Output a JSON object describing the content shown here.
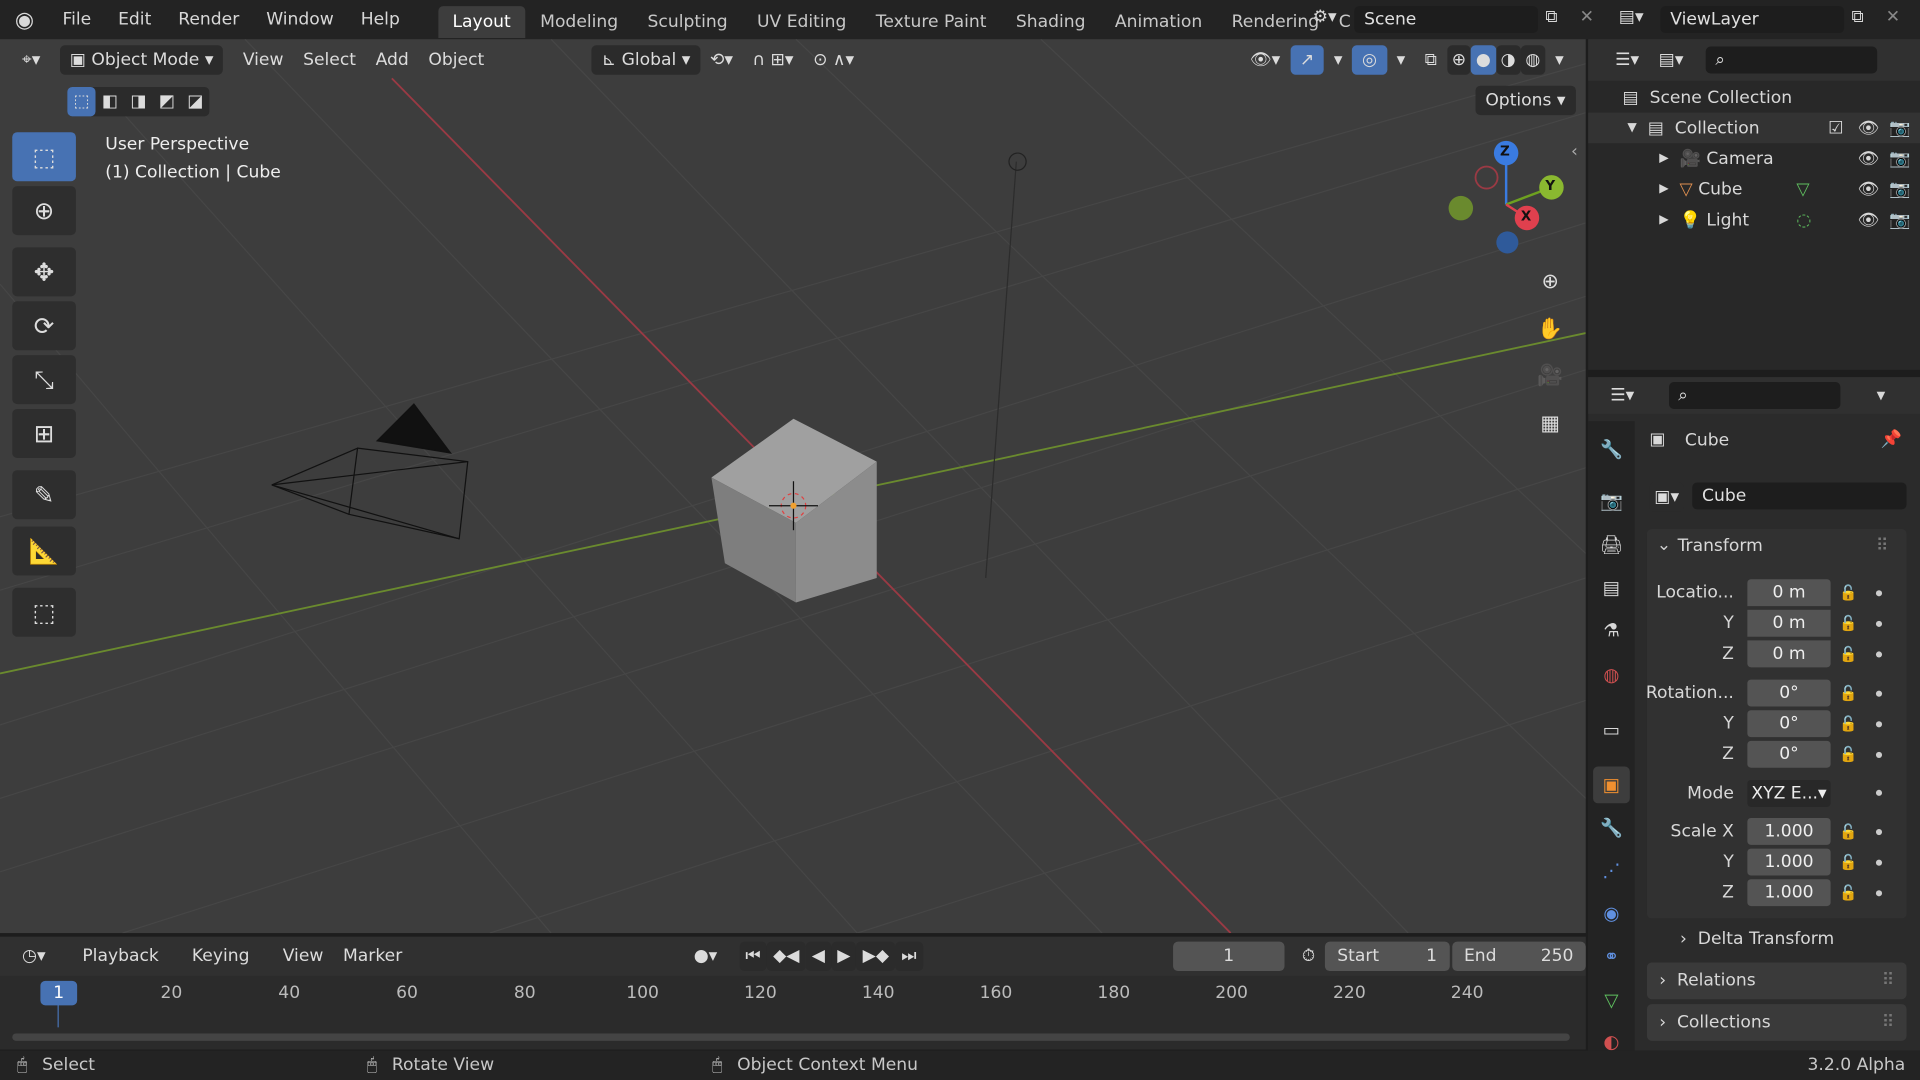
{
  "topbar": {
    "menus": [
      "File",
      "Edit",
      "Render",
      "Window",
      "Help"
    ],
    "workspaces": [
      "Layout",
      "Modeling",
      "Sculpting",
      "UV Editing",
      "Texture Paint",
      "Shading",
      "Animation",
      "Rendering",
      "C"
    ],
    "active_workspace": "Layout",
    "scene": "Scene",
    "view_layer": "ViewLayer"
  },
  "viewport": {
    "mode": "Object Mode",
    "menus": [
      "View",
      "Select",
      "Add",
      "Object"
    ],
    "orientation": "Global",
    "options": "Options",
    "overlay_title": "User Perspective",
    "overlay_subtitle": "(1) Collection | Cube",
    "gizmo": {
      "x": "X",
      "y": "Y",
      "z": "Z"
    },
    "tools": [
      "select-box",
      "cursor",
      "move",
      "rotate",
      "scale",
      "transform",
      "annotate",
      "measure",
      "add-cube"
    ],
    "colors": {
      "x_axis": "#c8303c",
      "y_axis": "#6e9a1e",
      "background": "#3d3d3d",
      "active": "#4772b3"
    }
  },
  "outliner": {
    "root": "Scene Collection",
    "collection": "Collection",
    "items": [
      {
        "name": "Camera",
        "icon": "camera"
      },
      {
        "name": "Cube",
        "icon": "mesh"
      },
      {
        "name": "Light",
        "icon": "light"
      }
    ]
  },
  "properties": {
    "object_name": "Cube",
    "data_name": "Cube",
    "transform_title": "Transform",
    "location": {
      "label": "Locatio...",
      "x": "0 m",
      "y": "0 m",
      "z": "0 m"
    },
    "rotation": {
      "label": "Rotation...",
      "x": "0°",
      "y": "0°",
      "z": "0°"
    },
    "mode_label": "Mode",
    "mode_value": "XYZ E...",
    "scale": {
      "label": "Scale X",
      "x": "1.000",
      "y": "1.000",
      "z": "1.000"
    },
    "axis_y": "Y",
    "axis_z": "Z",
    "delta": "Delta Transform",
    "relations": "Relations",
    "collections": "Collections"
  },
  "timeline": {
    "menus": [
      "Playback",
      "Keying",
      "View",
      "Marker"
    ],
    "current_frame": "1",
    "start_label": "Start",
    "start": "1",
    "end_label": "End",
    "end": "250",
    "ticks": [
      "20",
      "40",
      "60",
      "80",
      "100",
      "120",
      "140",
      "160",
      "180",
      "200",
      "220",
      "240"
    ],
    "playhead": "1"
  },
  "status": {
    "select": "Select",
    "rotate": "Rotate View",
    "context": "Object Context Menu",
    "version": "3.2.0 Alpha"
  }
}
